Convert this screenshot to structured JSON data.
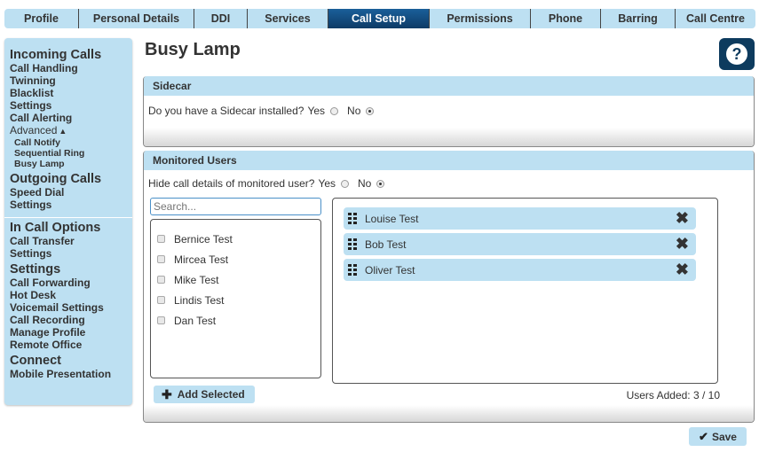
{
  "nav": {
    "tabs": [
      {
        "label": "Profile",
        "active": false
      },
      {
        "label": "Personal Details",
        "active": false
      },
      {
        "label": "DDI",
        "active": false
      },
      {
        "label": "Services",
        "active": false
      },
      {
        "label": "Call Setup",
        "active": true
      },
      {
        "label": "Permissions",
        "active": false
      },
      {
        "label": "Phone",
        "active": false
      },
      {
        "label": "Barring",
        "active": false
      },
      {
        "label": "Call Centre",
        "active": false
      }
    ]
  },
  "sidebar": {
    "incoming": {
      "title": "Incoming Calls",
      "items": [
        "Call Handling",
        "Twinning",
        "Blacklist",
        "Settings",
        "Call Alerting"
      ],
      "advanced_label": "Advanced",
      "advanced_icon": "caret-up-icon",
      "advanced_items": [
        "Call Notify",
        "Sequential Ring",
        "Busy Lamp"
      ]
    },
    "outgoing": {
      "title": "Outgoing Calls",
      "items": [
        "Speed Dial",
        "Settings"
      ]
    },
    "incall": {
      "title": "In Call Options",
      "items": [
        "Call Transfer",
        "Settings"
      ]
    },
    "settings": {
      "title": "Settings",
      "items": [
        "Call Forwarding",
        "Hot Desk",
        "Voicemail Settings",
        "Call Recording",
        "Manage Profile",
        "Remote Office"
      ]
    },
    "connect": {
      "title": "Connect",
      "items": [
        "Mobile Presentation"
      ]
    }
  },
  "page": {
    "title": "Busy Lamp",
    "help_icon": "?"
  },
  "sidecar": {
    "header": "Sidecar",
    "question": "Do you have a Sidecar installed?",
    "yes_label": "Yes",
    "no_label": "No",
    "selected": "No"
  },
  "monitored": {
    "header": "Monitored Users",
    "question": "Hide call details of monitored user?",
    "yes_label": "Yes",
    "no_label": "No",
    "selected": "No",
    "search_placeholder": "Search...",
    "available_users": [
      "Bernice Test",
      "Mircea Test",
      "Mike Test",
      "Lindis Test",
      "Dan Test"
    ],
    "selected_users": [
      "Louise Test",
      "Bob Test",
      "Oliver Test"
    ],
    "remove_icon": "✖",
    "add_button": "Add Selected",
    "add_icon": "✚",
    "users_added": "Users Added: 3 / 10"
  },
  "footer": {
    "save_button": "Save",
    "save_icon": "✔"
  },
  "colors": {
    "accent_light": "#bde0f2",
    "accent_dark": "#0d3b66"
  }
}
